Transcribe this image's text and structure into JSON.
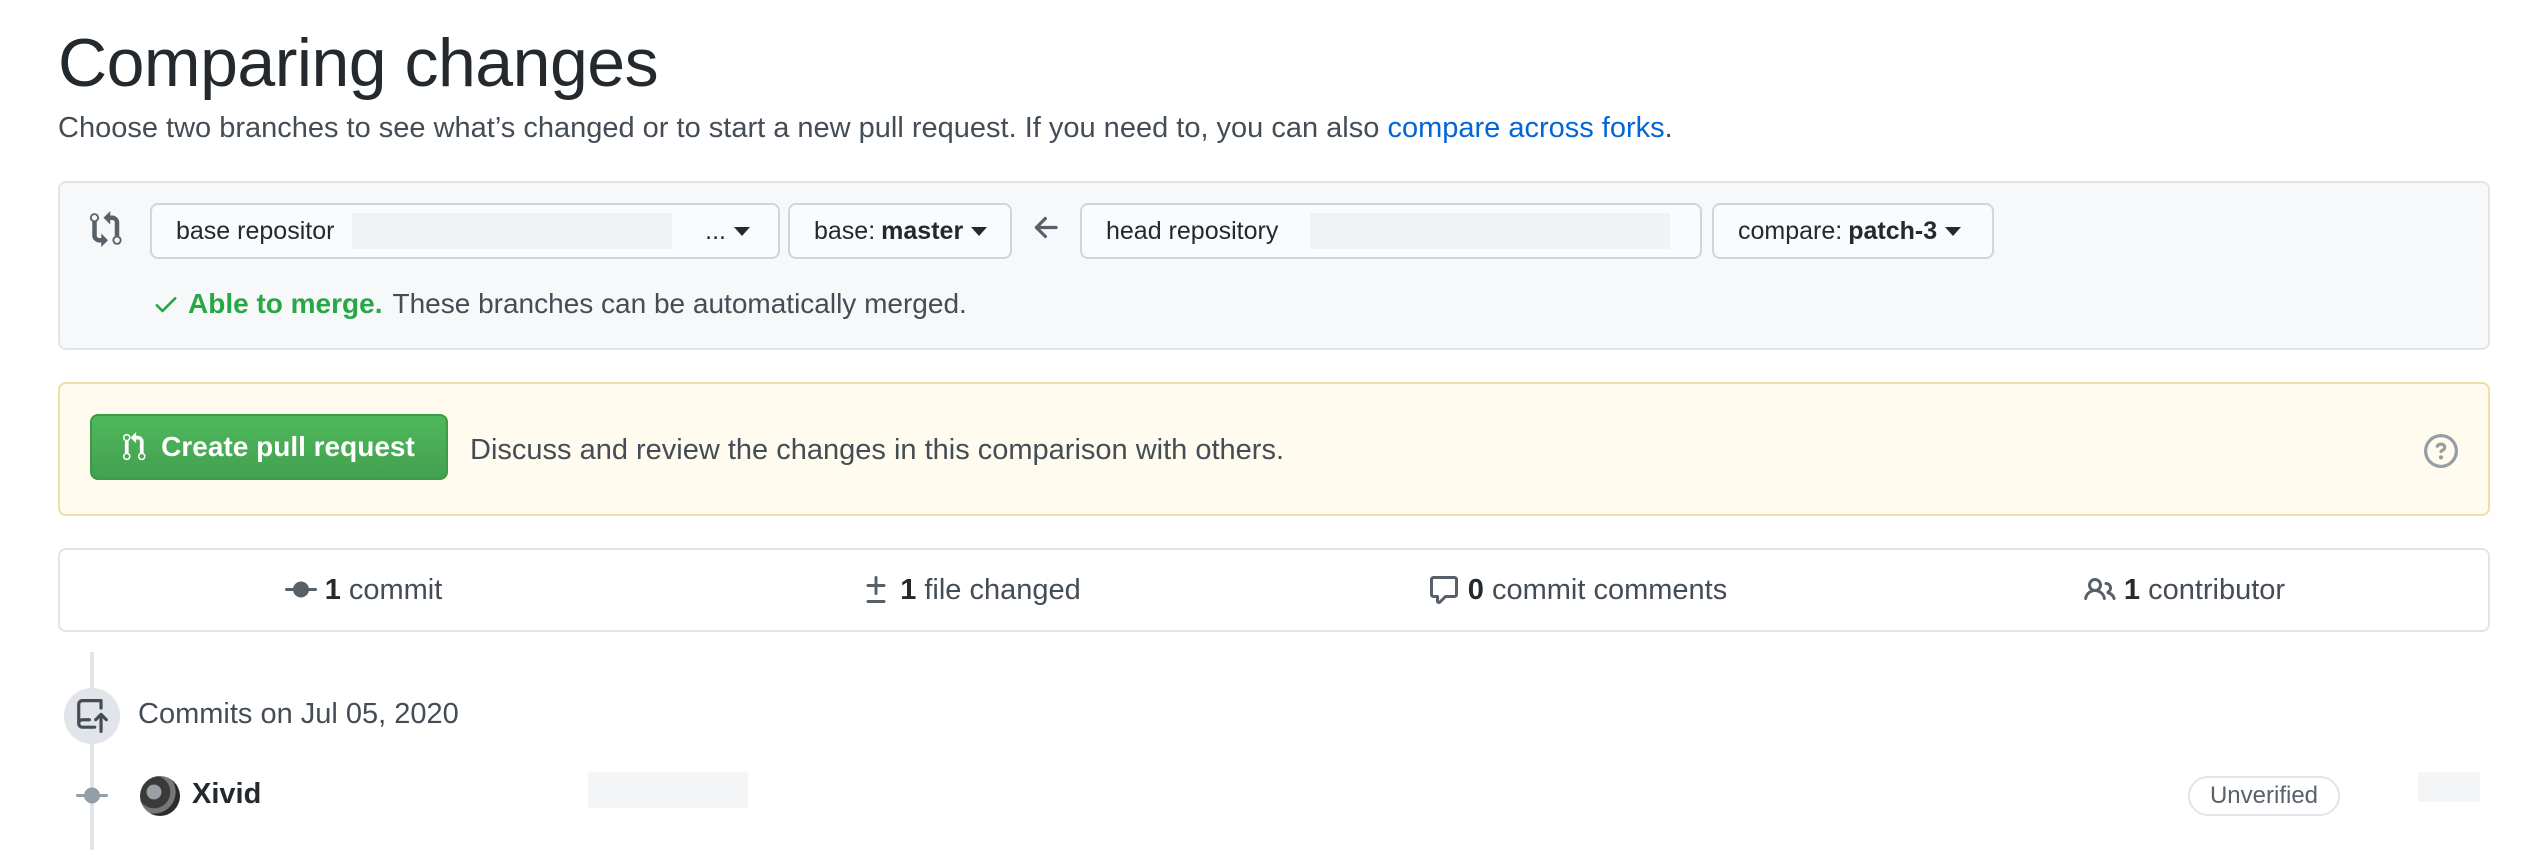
{
  "header": {
    "title": "Comparing changes",
    "description": "Choose two branches to see what’s changed or to start a new pull request. If you need to, you can also",
    "forks_link": "compare across forks",
    "description_end": "."
  },
  "range": {
    "base_repository_label": "base repositor",
    "base_repository_ellipsis": "...",
    "base_label": "base:",
    "base_branch": "master",
    "head_repository_label": "head repository",
    "compare_label": "compare:",
    "compare_branch": "patch-3",
    "merge_ok": "Able to merge.",
    "merge_text": "These branches can be automatically merged."
  },
  "pull_request": {
    "button_label": "Create pull request",
    "text": "Discuss and review the changes in this comparison with others."
  },
  "stats": {
    "commits_count": "1",
    "commits_label": "commit",
    "files_count": "1",
    "files_label": "file changed",
    "comments_count": "0",
    "comments_label": "commit comments",
    "contributors_count": "1",
    "contributors_label": "contributor"
  },
  "commits": {
    "group_title": "Commits on Jul 05, 2020",
    "author": "Xivid",
    "badge": "Unverified"
  },
  "colors": {
    "link": "#0366d6",
    "success": "#28a745",
    "button_green": "#43a04f",
    "notice_bg": "#fffbee"
  },
  "icons": [
    "git-compare-icon",
    "arrow-left-icon",
    "check-icon",
    "git-pull-request-icon",
    "question-icon",
    "git-commit-icon",
    "diff-icon",
    "comment-icon",
    "people-icon",
    "repo-push-icon"
  ]
}
